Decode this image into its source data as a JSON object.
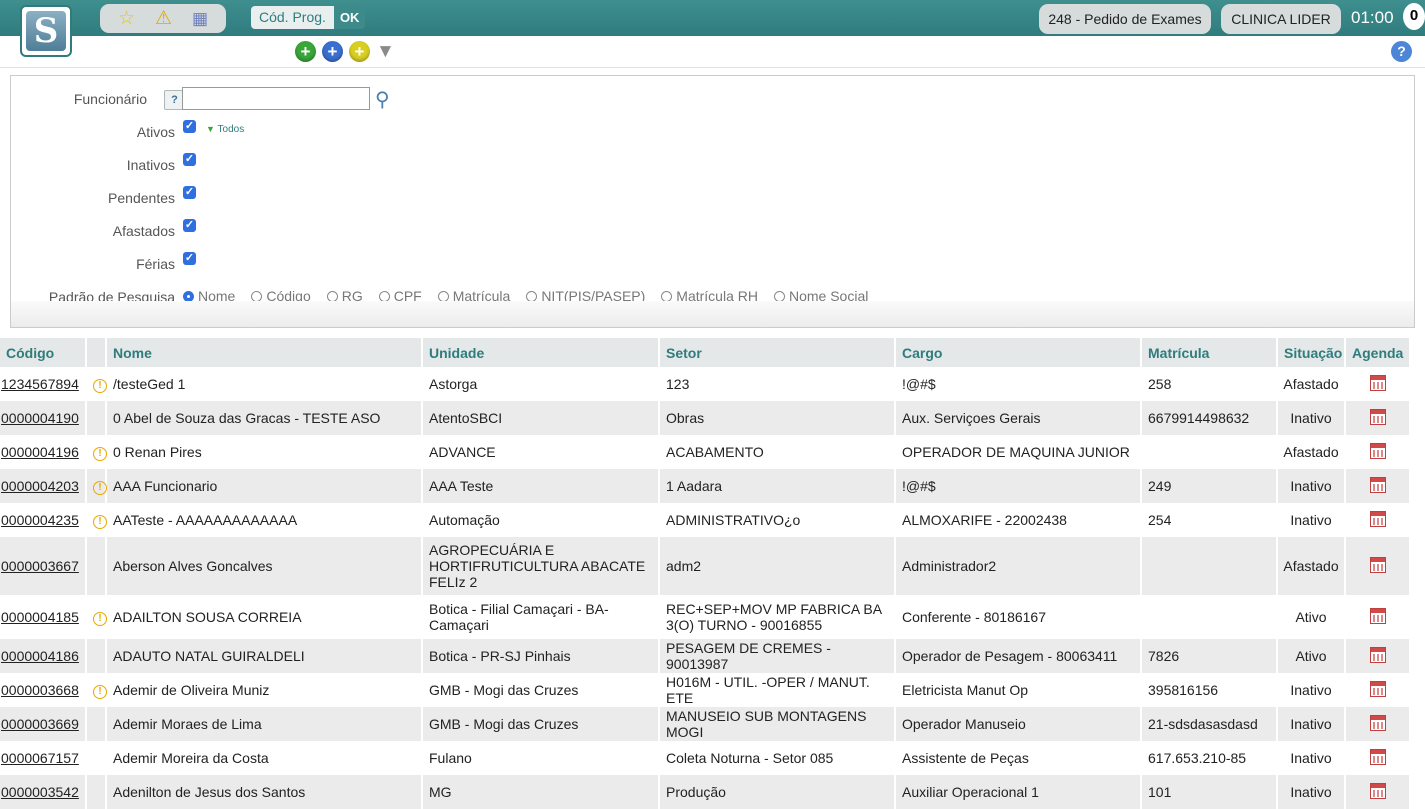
{
  "header": {
    "logo_letter": "S",
    "cod_prog_label": "Cód. Prog.",
    "ok_label": "OK",
    "program_pill": "248 - Pedido de Exames",
    "clinic_pill": "CLINICA LIDER",
    "clock": "01:00",
    "notif_count": "0"
  },
  "toolbar": {
    "help_label": "?"
  },
  "filters": {
    "funcionario_label": "Funcionário",
    "funcionario_help": "?",
    "funcionario_value": "",
    "todos_label": "Todos",
    "checks": [
      {
        "label": "Ativos",
        "checked": true
      },
      {
        "label": "Inativos",
        "checked": true
      },
      {
        "label": "Pendentes",
        "checked": true
      },
      {
        "label": "Afastados",
        "checked": true
      },
      {
        "label": "Férias",
        "checked": true
      }
    ],
    "padrao_label": "Padrão de Pesquisa",
    "radio_options": [
      "Nome",
      "Código",
      "RG",
      "CPF",
      "Matrícula",
      "NIT(PIS/PASEP)",
      "Matrícula RH",
      "Nome Social"
    ],
    "radio_selected": "Nome"
  },
  "table": {
    "headers": [
      "Código",
      "Nome",
      "Unidade",
      "Setor",
      "Cargo",
      "Matrícula",
      "Situação",
      "Agenda"
    ],
    "rows": [
      {
        "codigo": "1234567894",
        "warn": true,
        "nome": "/testeGed 1",
        "unidade": "Astorga",
        "setor": "123",
        "cargo": "!@#$",
        "matricula": "258",
        "situacao": "Afastado"
      },
      {
        "codigo": "0000004190",
        "warn": false,
        "nome": "0 Abel de Souza das Gracas  -  TESTE ASO",
        "unidade": "AtentoSBCI",
        "setor": "Obras",
        "cargo": "Aux. Serviçoes Gerais",
        "matricula": "6679914498632",
        "situacao": "Inativo"
      },
      {
        "codigo": "0000004196",
        "warn": true,
        "nome": "0 Renan Pires",
        "unidade": "ADVANCE",
        "setor": "ACABAMENTO",
        "cargo": "OPERADOR DE MAQUINA JUNIOR",
        "matricula": "",
        "situacao": "Afastado"
      },
      {
        "codigo": "0000004203",
        "warn": true,
        "nome": "AAA Funcionario",
        "unidade": "AAA Teste",
        "setor": "1 Aadara",
        "cargo": "!@#$",
        "matricula": "249",
        "situacao": "Inativo"
      },
      {
        "codigo": "0000004235",
        "warn": true,
        "nome": "AATeste  -  AAAAAAAAAAAAA",
        "unidade": "Automação",
        "setor": "ADMINISTRATIVO¿o",
        "cargo": "ALMOXARIFE - 22002438",
        "matricula": "254",
        "situacao": "Inativo"
      },
      {
        "codigo": "0000003667",
        "warn": false,
        "nome": "Aberson Alves Goncalves",
        "unidade": "AGROPECUÁRIA E HORTIFRUTICULTURA ABACATE FELIz 2",
        "setor": "adm2",
        "cargo": "Administrador2",
        "matricula": "",
        "situacao": "Afastado"
      },
      {
        "codigo": "0000004185",
        "warn": true,
        "nome": "ADAILTON SOUSA CORREIA",
        "unidade": "Botica - Filial Camaçari - BA-Camaçari",
        "setor": "REC+SEP+MOV MP FABRICA BA 3(O) TURNO - 90016855",
        "cargo": "Conferente - 80186167",
        "matricula": "",
        "situacao": "Ativo"
      },
      {
        "codigo": "0000004186",
        "warn": false,
        "nome": "ADAUTO NATAL GUIRALDELI",
        "unidade": "Botica - PR-SJ Pinhais",
        "setor": "PESAGEM DE CREMES - 90013987",
        "cargo": "Operador de Pesagem - 80063411",
        "matricula": "7826",
        "situacao": "Ativo"
      },
      {
        "codigo": "0000003668",
        "warn": true,
        "nome": "Ademir de Oliveira Muniz",
        "unidade": "GMB - Mogi das Cruzes",
        "setor": "H016M - UTIL. -OPER / MANUT. ETE",
        "cargo": "Eletricista Manut Op",
        "matricula": "395816156",
        "situacao": "Inativo"
      },
      {
        "codigo": "0000003669",
        "warn": false,
        "nome": "Ademir Moraes de Lima",
        "unidade": "GMB - Mogi das Cruzes",
        "setor": "MANUSEIO SUB MONTAGENS MOGI",
        "cargo": "Operador Manuseio",
        "matricula": "21-sdsdasasdasd",
        "situacao": "Inativo"
      },
      {
        "codigo": "0000067157",
        "warn": false,
        "nome": "Ademir Moreira da Costa",
        "unidade": "Fulano",
        "setor": "Coleta Noturna - Setor 085",
        "cargo": "Assistente de Peças",
        "matricula": "617.653.210-85",
        "situacao": "Inativo"
      },
      {
        "codigo": "0000003542",
        "warn": false,
        "nome": "Adenilton de Jesus dos Santos",
        "unidade": "MG",
        "setor": "Produção",
        "cargo": "Auxiliar Operacional 1",
        "matricula": "101",
        "situacao": "Inativo"
      }
    ]
  }
}
